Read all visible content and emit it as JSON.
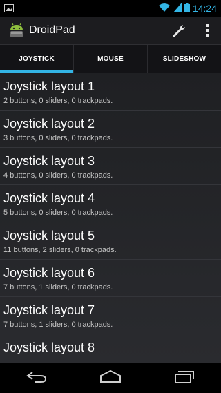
{
  "status": {
    "time": "14:24"
  },
  "app": {
    "title": "DroidPad"
  },
  "tabs": [
    {
      "label": "JOYSTICK",
      "selected": true
    },
    {
      "label": "MOUSE",
      "selected": false
    },
    {
      "label": "SLIDESHOW",
      "selected": false
    }
  ],
  "layouts": [
    {
      "title": "Joystick layout 1",
      "summary": "2 buttons, 0 sliders, 0 trackpads."
    },
    {
      "title": "Joystick layout 2",
      "summary": "3 buttons, 0 sliders, 0 trackpads."
    },
    {
      "title": "Joystick layout 3",
      "summary": "4 buttons, 0 sliders, 0 trackpads."
    },
    {
      "title": "Joystick layout 4",
      "summary": "5 buttons, 0 sliders, 0 trackpads."
    },
    {
      "title": "Joystick layout 5",
      "summary": "11 buttons, 2 sliders, 0 trackpads."
    },
    {
      "title": "Joystick layout 6",
      "summary": "7 buttons, 1 sliders, 0 trackpads."
    },
    {
      "title": "Joystick layout 7",
      "summary": "7 buttons, 1 sliders, 0 trackpads."
    },
    {
      "title": "Joystick layout 8",
      "summary": ""
    }
  ],
  "colors": {
    "accent": "#33b5e5"
  },
  "icons": {
    "status_left": "gallery-notification-icon",
    "wifi": "wifi-icon",
    "signal": "signal-icon",
    "battery": "battery-icon",
    "app": "android-robot-icon",
    "settings": "wrench-icon",
    "overflow": "overflow-menu-icon",
    "back": "back-icon",
    "home": "home-icon",
    "recents": "recents-icon"
  }
}
